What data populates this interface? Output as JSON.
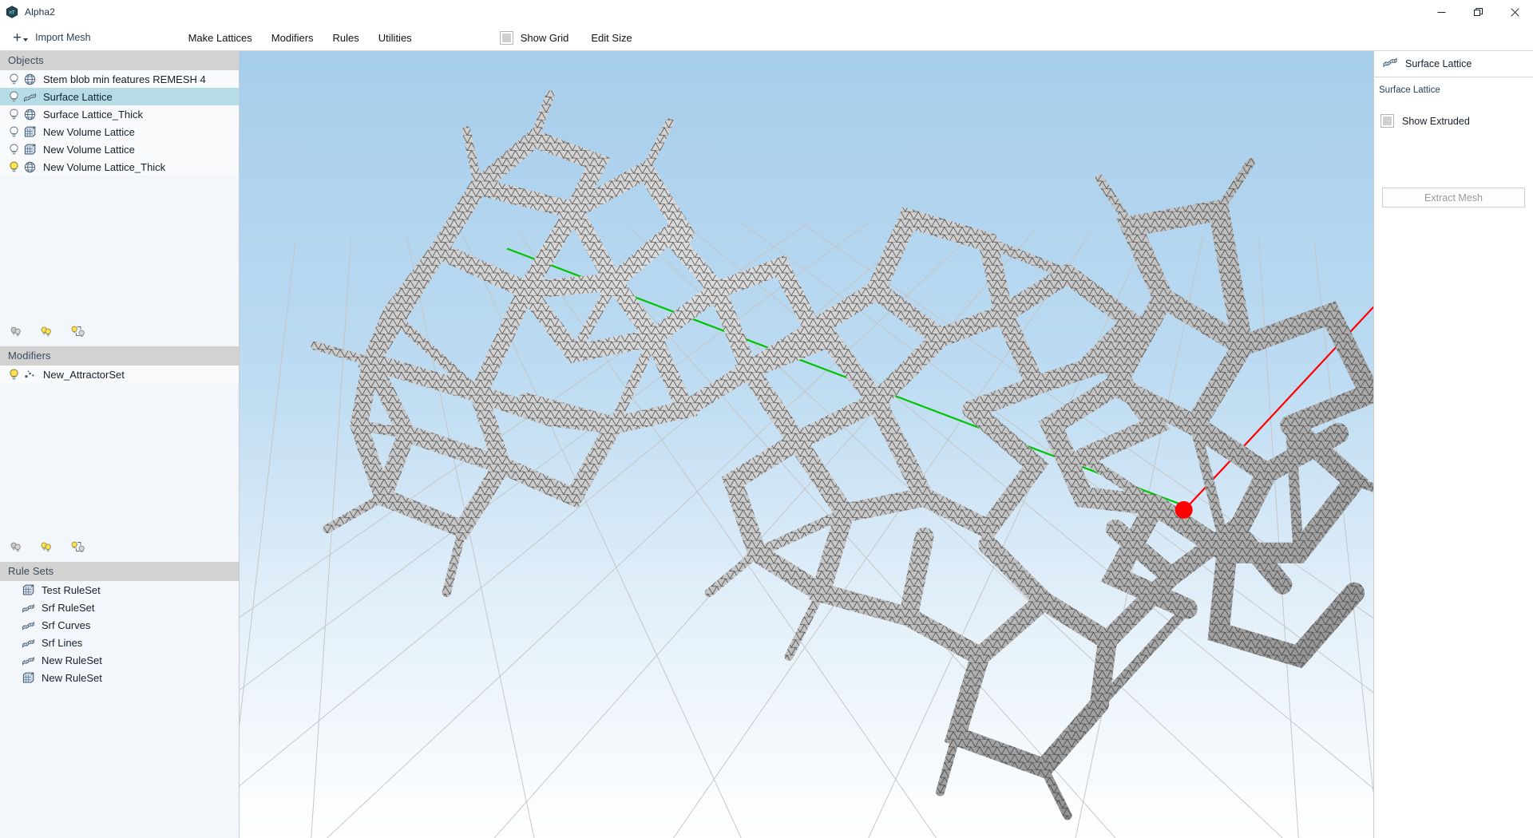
{
  "window": {
    "title": "Alpha2",
    "app_icon": "app-logo-icon",
    "controls": [
      {
        "name": "minimize",
        "glyph": "—"
      },
      {
        "name": "restore",
        "glyph": "❐"
      },
      {
        "name": "close",
        "glyph": "✕"
      }
    ]
  },
  "toolbar": {
    "import_label": "Import Mesh",
    "import_icon": "plus-icon",
    "import_caret": "chevron-down-icon",
    "menus": [
      {
        "label": "Make Lattices"
      },
      {
        "label": "Modifiers"
      },
      {
        "label": "Rules"
      },
      {
        "label": "Utilities"
      }
    ],
    "show_grid": {
      "label": "Show Grid",
      "checked": false
    },
    "edit_size": {
      "label": "Edit Size"
    }
  },
  "left_panel": {
    "objects": {
      "header": "Objects",
      "items": [
        {
          "label": "Stem blob min features REMESH 4",
          "icon": "mesh-globe-icon",
          "bulb": "off",
          "selected": false
        },
        {
          "label": "Surface Lattice",
          "icon": "surface-lattice-icon",
          "bulb": "off",
          "selected": true
        },
        {
          "label": "Surface Lattice_Thick",
          "icon": "mesh-globe-icon",
          "bulb": "off",
          "selected": false
        },
        {
          "label": "New Volume Lattice",
          "icon": "volume-lattice-icon",
          "bulb": "off",
          "selected": false
        },
        {
          "label": "New Volume Lattice",
          "icon": "volume-lattice-icon",
          "bulb": "off",
          "selected": false
        },
        {
          "label": "New Volume Lattice_Thick",
          "icon": "mesh-globe-icon",
          "bulb": "on",
          "selected": false
        }
      ],
      "visibility_buttons": [
        {
          "name": "hide-all-icon"
        },
        {
          "name": "show-all-icon"
        },
        {
          "name": "invert-visibility-icon"
        }
      ]
    },
    "modifiers": {
      "header": "Modifiers",
      "items": [
        {
          "label": "New_AttractorSet",
          "icon": "attractor-points-icon",
          "bulb": "on"
        }
      ],
      "visibility_buttons": [
        {
          "name": "hide-all-icon"
        },
        {
          "name": "show-all-icon"
        },
        {
          "name": "invert-visibility-icon"
        }
      ]
    },
    "rule_sets": {
      "header": "Rule Sets",
      "items": [
        {
          "label": "Test RuleSet",
          "icon": "volume-lattice-icon"
        },
        {
          "label": "Srf RuleSet",
          "icon": "surface-lattice-icon"
        },
        {
          "label": "Srf Curves",
          "icon": "surface-lattice-icon"
        },
        {
          "label": "Srf Lines",
          "icon": "surface-lattice-icon"
        },
        {
          "label": "New RuleSet",
          "icon": "surface-lattice-icon"
        },
        {
          "label": "New RuleSet",
          "icon": "volume-lattice-icon"
        }
      ]
    }
  },
  "right_panel": {
    "header_title": "Surface Lattice",
    "header_icon": "surface-lattice-icon",
    "subtitle": "Surface Lattice",
    "show_extruded": {
      "label": "Show Extruded",
      "checked": false
    },
    "extract_mesh_button": {
      "label": "Extract Mesh",
      "enabled": false
    }
  },
  "viewport": {
    "name": "3d-viewport",
    "sky_color_top": "#a9cfec",
    "sky_color_bottom": "#ffffff",
    "grid_color": "#c8c8c8",
    "mesh_color": "#d9d9d9",
    "mesh_wire_color": "#2b2b2b",
    "axis_x_color": "#ff0000",
    "axis_y_color": "#00c000",
    "attractor_point_color": "#ff0000"
  }
}
